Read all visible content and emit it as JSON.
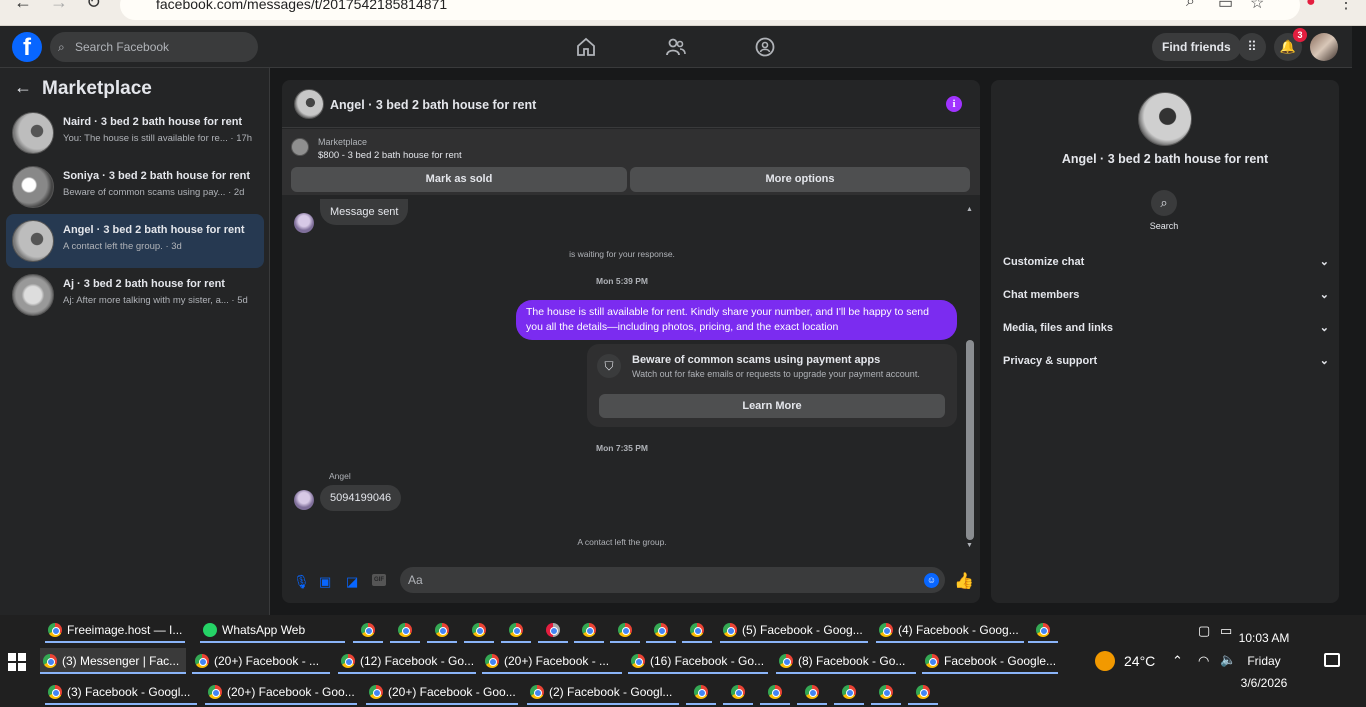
{
  "browser": {
    "url": "facebook.com/messages/t/2017542185814871"
  },
  "topbar": {
    "search_placeholder": "Search Facebook",
    "find_friends": "Find friends",
    "notif_count": "3"
  },
  "left": {
    "title": "Marketplace",
    "chats": [
      {
        "name": "Naird · 3 bed 2 bath house for rent",
        "preview": "You: The house is still available for re... · 17h"
      },
      {
        "name": "Soniya · 3 bed 2 bath house for rent",
        "preview": "Beware of common scams using pay... · 2d"
      },
      {
        "name": "Angel · 3 bed 2 bath house for rent",
        "preview": "A contact left the group. · 3d"
      },
      {
        "name": "Aj · 3 bed 2 bath house for rent",
        "preview": "Aj: After more talking with my sister, a... · 5d"
      }
    ]
  },
  "conversation": {
    "title": "Angel · 3 bed 2 bath house for rent",
    "marketplace_label": "Marketplace",
    "listing": "$800 - 3 bed 2 bath house for rent",
    "mark_sold": "Mark as sold",
    "more_options": "More options",
    "msg_sent": "Message sent",
    "waiting": "is waiting for your response.",
    "ts1": "Mon 5:39 PM",
    "outgoing": "The house is still available for rent. Kindly share your number, and I'll be happy to send you all the details—including photos, pricing, and the exact location",
    "scam_title": "Beware of common scams using payment apps",
    "scam_text": "Watch out for fake emails or requests to upgrade your payment account.",
    "learn_more": "Learn More",
    "ts2": "Mon 7:35 PM",
    "sender": "Angel",
    "number_msg": "5094199046",
    "left_group": "A contact left the group.",
    "composer_placeholder": "Aa"
  },
  "right": {
    "name": "Angel · 3 bed 2 bath house for rent",
    "search_label": "Search",
    "sections": [
      "Customize chat",
      "Chat members",
      "Media, files and links",
      "Privacy & support"
    ]
  },
  "taskbar": {
    "row1": [
      "Freeimage.host — I...",
      "WhatsApp Web",
      "(5) Facebook - Goog...",
      "(4) Facebook - Goog..."
    ],
    "row2": [
      "(3) Messenger | Fac...",
      "(20+) Facebook - ...",
      "(12) Facebook - Go...",
      "(20+) Facebook - ...",
      "(16) Facebook - Go...",
      "(8) Facebook - Go...",
      "Facebook - Google..."
    ],
    "row3": [
      "(3) Facebook - Googl...",
      "(20+) Facebook - Goo...",
      "(20+) Facebook - Goo...",
      "(2) Facebook - Googl..."
    ],
    "temperature": "24°C",
    "time": "10:03 AM",
    "day": "Friday",
    "date": "3/6/2026"
  },
  "colors": {
    "accent": "#0866ff",
    "outgoing_bubble": "#7b2cf0",
    "active_chat": "#263951"
  }
}
